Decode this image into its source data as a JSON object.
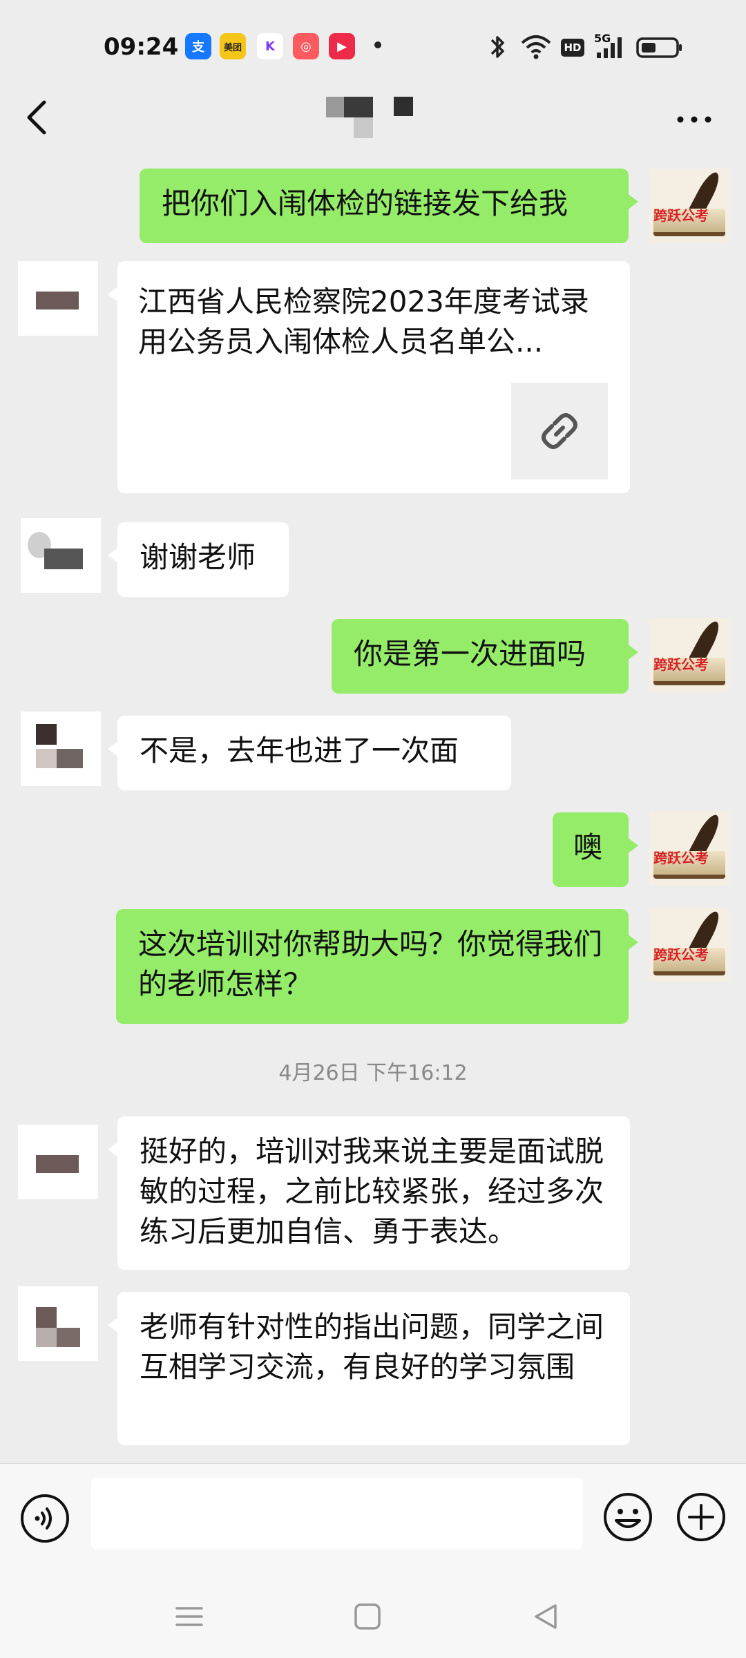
{
  "status_bar": {
    "time": "09:24",
    "apps": [
      {
        "icon": "alipay-icon",
        "glyph": "支",
        "color": "#1677ff"
      },
      {
        "icon": "meituan-icon",
        "glyph": "美团",
        "color": "#f5c518"
      },
      {
        "icon": "k-app-icon",
        "glyph": "K",
        "color": "#ffffff"
      },
      {
        "icon": "camera-app-icon",
        "glyph": "◎",
        "color": "#ff5a5f"
      },
      {
        "icon": "video-app-icon",
        "glyph": "▶",
        "color": "#ee2a4a"
      }
    ],
    "network": "5G",
    "hd": "HD"
  },
  "chat": {
    "messages": [
      {
        "side": "right",
        "type": "text",
        "text": "把你们入闱体检的链接发下给我"
      },
      {
        "side": "left",
        "type": "link",
        "text": "江西省人民检察院2023年度考试录用公务员入闱体检人员名单公..."
      },
      {
        "side": "left",
        "type": "text",
        "text": "谢谢老师"
      },
      {
        "side": "right",
        "type": "text",
        "text": "你是第一次进面吗"
      },
      {
        "side": "left",
        "type": "text",
        "text": "不是，去年也进了一次面"
      },
      {
        "side": "right",
        "type": "text",
        "text": "噢"
      },
      {
        "side": "right",
        "type": "text",
        "text": "这次培训对你帮助大吗？你觉得我们的老师怎样？"
      },
      {
        "side": "left",
        "type": "text",
        "text": "挺好的，培训对我来说主要是面试脱敏的过程，之前比较紧张，经过多次练习后更加自信、勇于表达。"
      },
      {
        "side": "left",
        "type": "text",
        "text": "老师有针对性的指出问题，同学之间互相学习交流，有良好的学习氛围"
      }
    ],
    "timestamp": "4月26日 下午16:12",
    "brand_avatar_text": "跨跃公考"
  },
  "colors": {
    "sent_bubble": "#95ec69",
    "received_bubble": "#ffffff",
    "background": "#ededed"
  }
}
